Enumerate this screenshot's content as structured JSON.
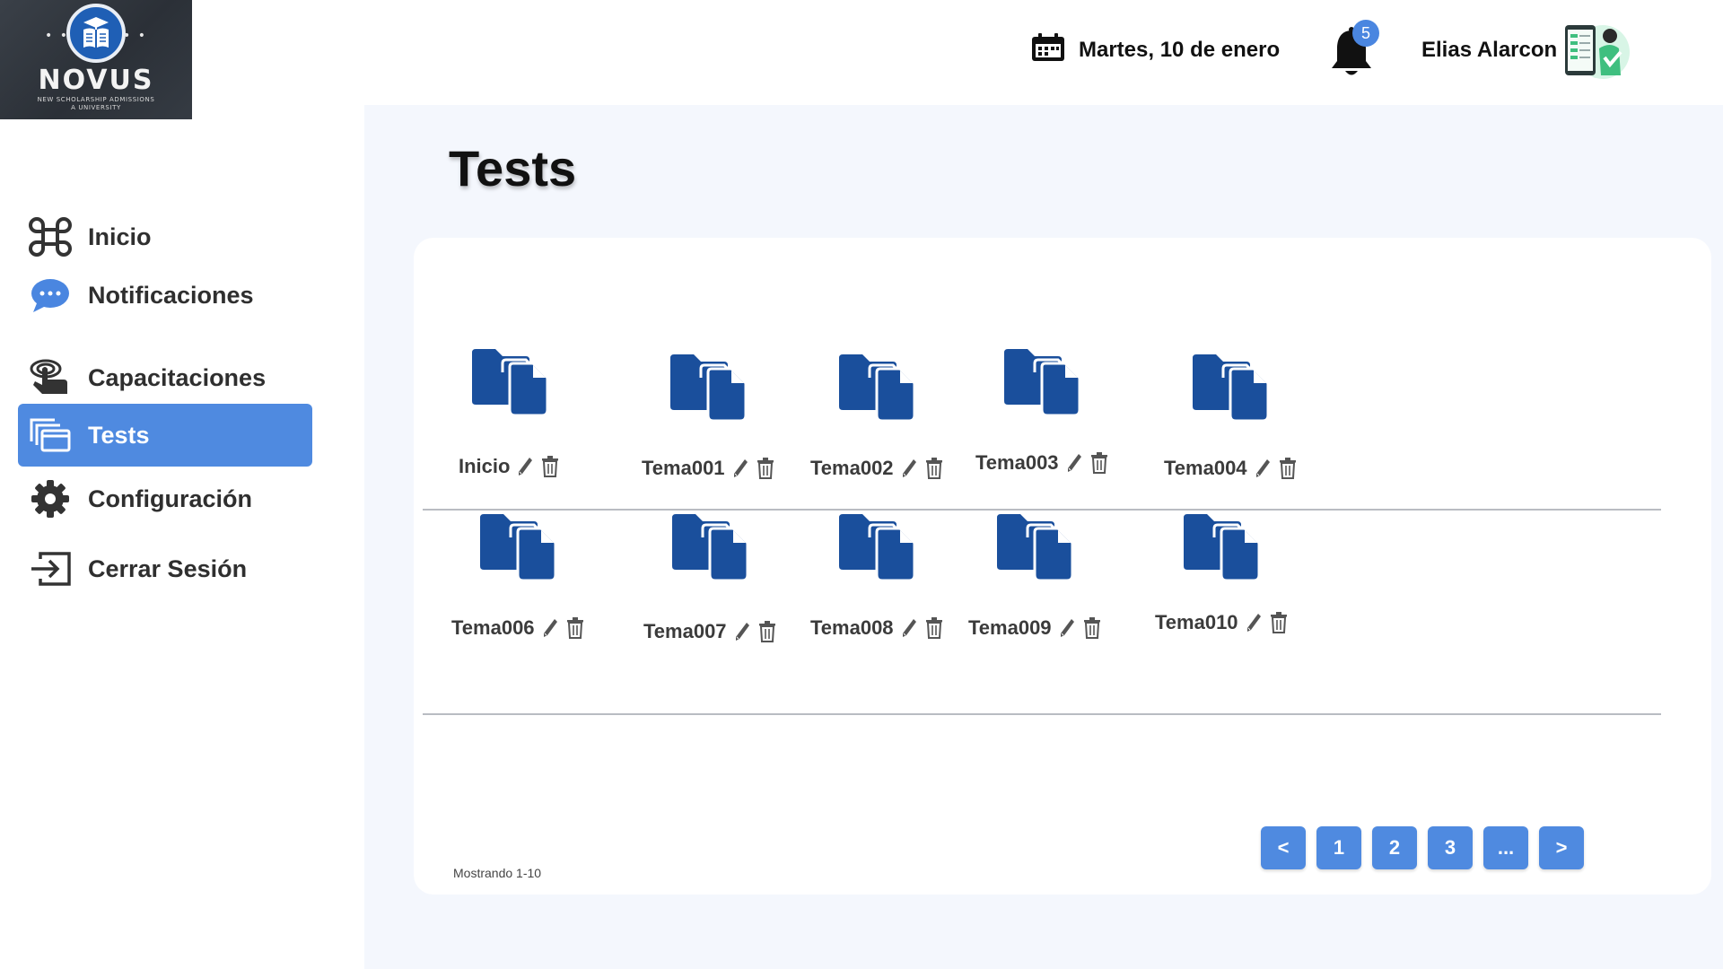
{
  "brand": {
    "name": "NOVUS",
    "subtitle_line1": "NEW SCHOLARSHIP ADMISSIONS",
    "subtitle_line2": "A UNIVERSITY",
    "color": "#1f5fb5"
  },
  "header": {
    "date": "Martes, 10 de enero",
    "notification_count": "5",
    "user_name": "Elias Alarcon"
  },
  "sidebar": {
    "items": [
      {
        "label": "Inicio",
        "icon": "command-icon"
      },
      {
        "label": "Notificaciones",
        "icon": "chat-bubble-icon"
      },
      {
        "label": "Capacitaciones",
        "icon": "touch-hand-icon"
      },
      {
        "label": "Tests",
        "icon": "copy-windows-icon",
        "active": true
      },
      {
        "label": "Configuración",
        "icon": "gear-icon"
      },
      {
        "label": "Cerrar Sesión",
        "icon": "logout-icon"
      }
    ]
  },
  "main": {
    "title": "Tests",
    "folders": [
      {
        "label": "Inicio"
      },
      {
        "label": "Tema001"
      },
      {
        "label": "Tema002"
      },
      {
        "label": "Tema003"
      },
      {
        "label": "Tema004"
      },
      {
        "label": "Tema006"
      },
      {
        "label": "Tema007"
      },
      {
        "label": "Tema008"
      },
      {
        "label": "Tema009"
      },
      {
        "label": "Tema010"
      }
    ],
    "showing": "Mostrando 1-10",
    "pagination": [
      "<",
      "1",
      "2",
      "3",
      "...",
      ">"
    ]
  },
  "colors": {
    "accent": "#4f8ae0",
    "folder": "#1a4f9c",
    "background": "#f4f7fd"
  }
}
